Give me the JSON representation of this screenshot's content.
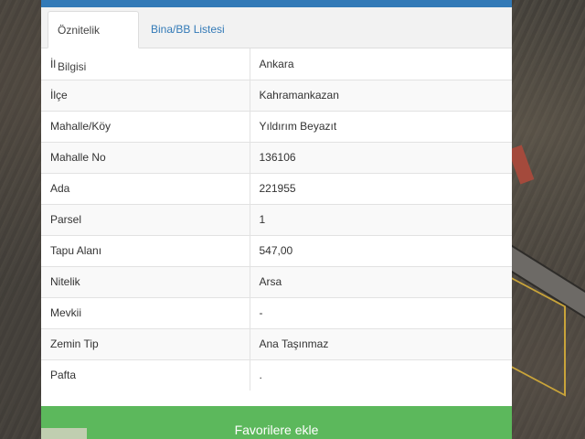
{
  "tabs": [
    {
      "label": "Öznitelik Bilgisi",
      "active": true
    },
    {
      "label": "Bina/BB Listesi",
      "active": false
    }
  ],
  "attributes": [
    {
      "key": "İl",
      "value": "Ankara"
    },
    {
      "key": "İlçe",
      "value": "Kahramankazan"
    },
    {
      "key": "Mahalle/Köy",
      "value": "Yıldırım Beyazıt"
    },
    {
      "key": "Mahalle No",
      "value": "136106"
    },
    {
      "key": "Ada",
      "value": "221955"
    },
    {
      "key": "Parsel",
      "value": "1"
    },
    {
      "key": "Tapu Alanı",
      "value": "547,00"
    },
    {
      "key": "Nitelik",
      "value": "Arsa"
    },
    {
      "key": "Mevkii",
      "value": "-"
    },
    {
      "key": "Zemin Tip",
      "value": "Ana Taşınmaz"
    },
    {
      "key": "Pafta",
      "value": "."
    }
  ],
  "actions": {
    "favorite_label": "Favorilere ekle"
  },
  "colors": {
    "accent": "#337ab7",
    "favorite_button": "#5cb85c"
  }
}
